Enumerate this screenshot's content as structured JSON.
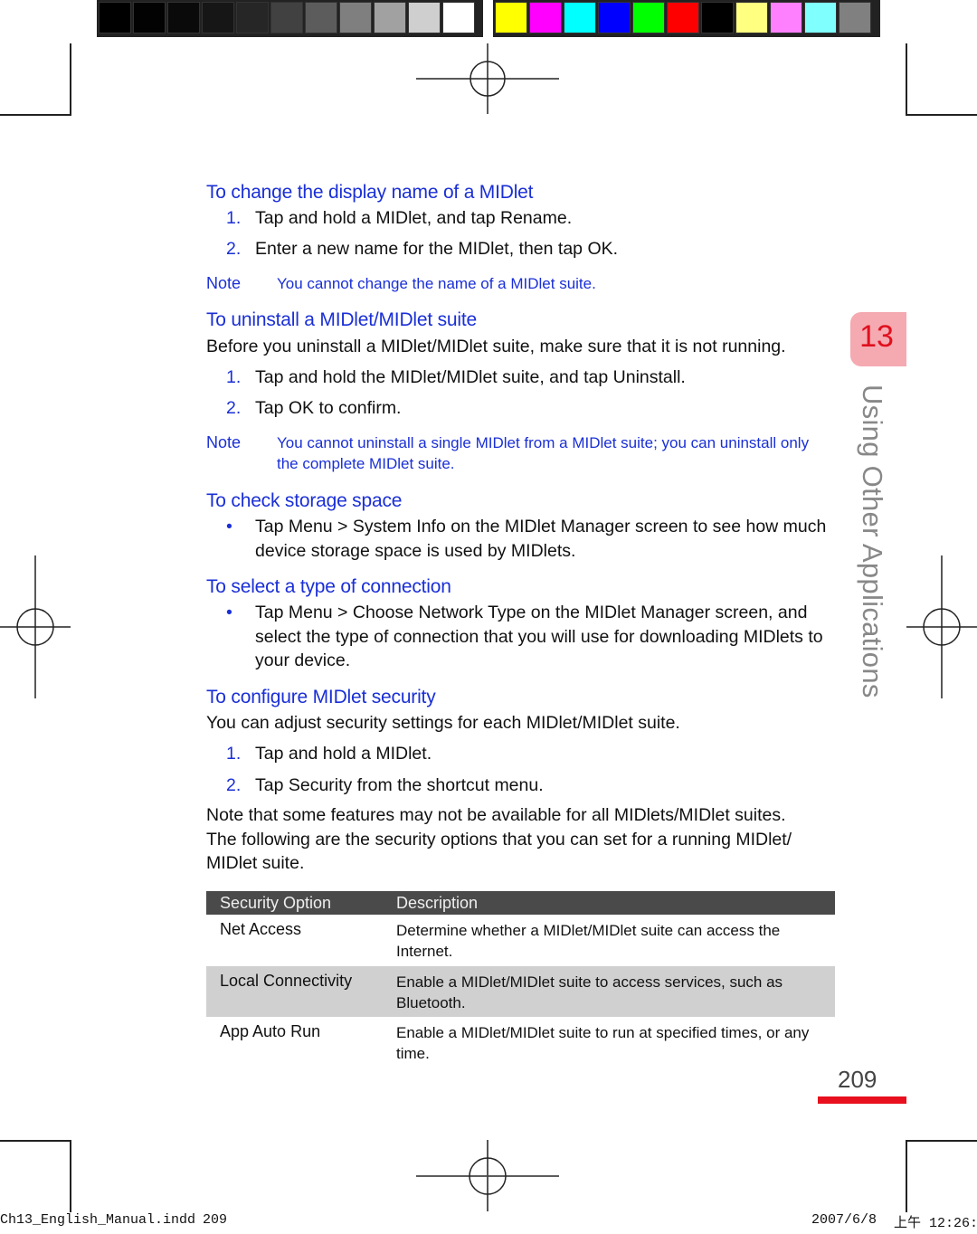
{
  "color_bars": {
    "grayscale": [
      "#000000",
      "#020202",
      "#0a0a0a",
      "#161616",
      "#262626",
      "#414141",
      "#5c5c5c",
      "#7f7f7f",
      "#a1a1a1",
      "#cfcfcf",
      "#ffffff"
    ],
    "process": [
      "#ffff00",
      "#ff00ff",
      "#00ffff",
      "#0000ff",
      "#00ff00",
      "#ff0000",
      "#000000",
      "#ffff80",
      "#ff80ff",
      "#80ffff",
      "#808080"
    ]
  },
  "sections": {
    "rename": {
      "heading": "To change the display name of a MIDlet",
      "steps": [
        {
          "num": "1.",
          "text": "Tap and hold a MIDlet, and tap Rename."
        },
        {
          "num": "2.",
          "text": "Enter a new name for the MIDlet, then tap OK."
        }
      ],
      "note_label": "Note",
      "note_text": "You cannot change the name of a MIDlet suite."
    },
    "uninstall": {
      "heading": "To uninstall a MIDlet/MIDlet suite",
      "intro": "Before you uninstall a MIDlet/MIDlet suite, make sure that it is not running.",
      "steps": [
        {
          "num": "1.",
          "text": "Tap and hold the MIDlet/MIDlet suite, and tap Uninstall."
        },
        {
          "num": "2.",
          "text": "Tap OK to confirm."
        }
      ],
      "note_label": "Note",
      "note_text": "You cannot uninstall a single MIDlet from a MIDlet suite; you can uninstall only the complete MIDlet suite."
    },
    "storage": {
      "heading": "To check storage space",
      "bullet": "•",
      "text": "Tap Menu > System Info on the MIDlet Manager screen to see how much device storage space is used by MIDlets."
    },
    "connection": {
      "heading": "To select a type of connection",
      "bullet": "•",
      "text": "Tap Menu > Choose Network Type on the MIDlet Manager screen, and select the type of connection that you will use for downloading MIDlets to your device."
    },
    "security": {
      "heading": "To configure MIDlet security",
      "intro": "You can adjust security settings for each MIDlet/MIDlet suite.",
      "steps": [
        {
          "num": "1.",
          "text": "Tap and hold a MIDlet."
        },
        {
          "num": "2.",
          "text": "Tap Security from the shortcut menu."
        }
      ],
      "outro_lines": [
        "Note that some features may not be available for all MIDlets/MIDlet suites.",
        "The following are the security options that you can set for a running MIDlet/",
        "MIDlet suite."
      ]
    }
  },
  "table": {
    "headers": [
      "Security Option",
      "Description"
    ],
    "rows": [
      {
        "option": "Net Access",
        "description": "Determine whether a MIDlet/MIDlet suite can access the Internet."
      },
      {
        "option": "Local Connectivity",
        "description": "Enable a MIDlet/MIDlet suite to access services, such as Bluetooth."
      },
      {
        "option": "App Auto Run",
        "description": "Enable a MIDlet/MIDlet suite to run at specified times, or any time."
      }
    ]
  },
  "chapter": {
    "number": "13",
    "title": "Using Other Applications"
  },
  "page_number": "209",
  "slug": {
    "file": "Ch13_English_Manual.indd",
    "page": "209",
    "date": "2007/6/8",
    "time": "上午 12:26:"
  },
  "colors": {
    "accent_blue": "#1a2fd6",
    "accent_red": "#e8101e",
    "tab_pink": "#f5a9b1"
  }
}
